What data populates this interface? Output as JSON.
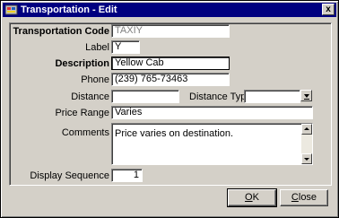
{
  "window": {
    "title": "Transportation - Edit",
    "close_glyph": "x"
  },
  "form": {
    "transportation_code": {
      "label": "Transportation Code",
      "value": "TAXIY"
    },
    "label_field": {
      "label": "Label",
      "value": "Y"
    },
    "description": {
      "label": "Description",
      "value": "Yellow Cab"
    },
    "phone": {
      "label": "Phone",
      "value": "(239) 765-73463"
    },
    "distance": {
      "label": "Distance",
      "value": ""
    },
    "distance_type": {
      "label": "Distance Type",
      "value": ""
    },
    "price_range": {
      "label": "Price Range",
      "value": "Varies"
    },
    "comments": {
      "label": "Comments",
      "value": "Price varies on destination."
    },
    "display_sequence": {
      "label": "Display Sequence",
      "value": "1"
    }
  },
  "buttons": {
    "ok": {
      "mnemonic": "O",
      "rest": "K"
    },
    "close": {
      "mnemonic": "C",
      "rest": "lose"
    }
  },
  "colors": {
    "titlebar": "#000080",
    "face": "#d4d0c8"
  },
  "icons": [
    "app-icon",
    "close-x-icon",
    "dropdown-arrow-icon",
    "scroll-up-icon",
    "scroll-down-icon"
  ]
}
